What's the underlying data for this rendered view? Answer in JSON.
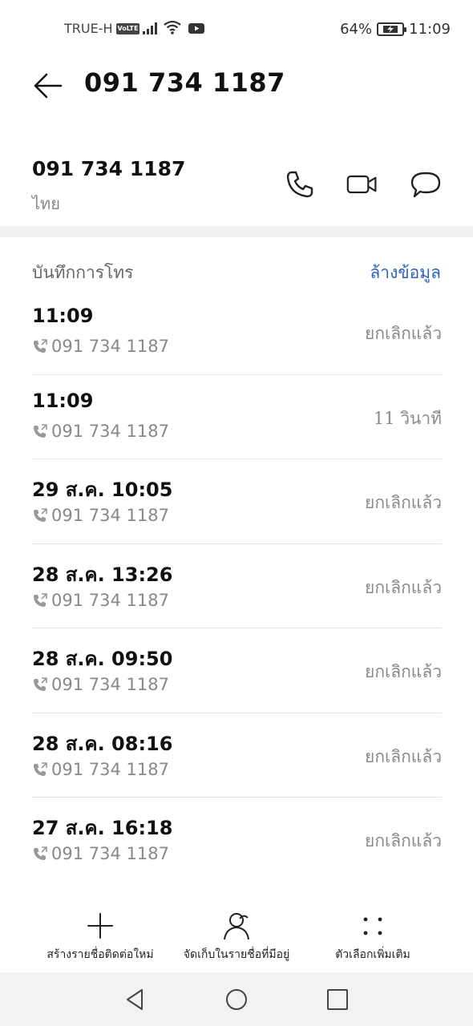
{
  "status": {
    "carrier": "TRUE-H",
    "volte": "VoLTE",
    "battery": "64%",
    "time": "11:09"
  },
  "header": {
    "title": "091 734 1187"
  },
  "contact": {
    "number": "091 734 1187",
    "location": "ไทย"
  },
  "log": {
    "label": "บันทึกการโทร",
    "clear": "ล้างข้อมูล",
    "entries": [
      {
        "time": "11:09",
        "number": "091 734 1187",
        "status": "ยกเลิกแล้ว"
      },
      {
        "time": "11:09",
        "number": "091 734 1187",
        "status": "11 วินาที"
      },
      {
        "time": "29 ส.ค. 10:05",
        "number": "091 734 1187",
        "status": "ยกเลิกแล้ว"
      },
      {
        "time": "28 ส.ค. 13:26",
        "number": "091 734 1187",
        "status": "ยกเลิกแล้ว"
      },
      {
        "time": "28 ส.ค. 09:50",
        "number": "091 734 1187",
        "status": "ยกเลิกแล้ว"
      },
      {
        "time": "28 ส.ค. 08:16",
        "number": "091 734 1187",
        "status": "ยกเลิกแล้ว"
      },
      {
        "time": "27 ส.ค. 16:18",
        "number": "091 734 1187",
        "status": "ยกเลิกแล้ว"
      }
    ]
  },
  "actions": {
    "new_contact": "สร้างรายชื่อติดต่อใหม่",
    "save_existing": "จัดเก็บในรายชื่อที่มีอยู่",
    "more": "ตัวเลือกเพิ่มเติม"
  },
  "colors": {
    "accent": "#2a63c5",
    "secondary_text": "#888888"
  }
}
